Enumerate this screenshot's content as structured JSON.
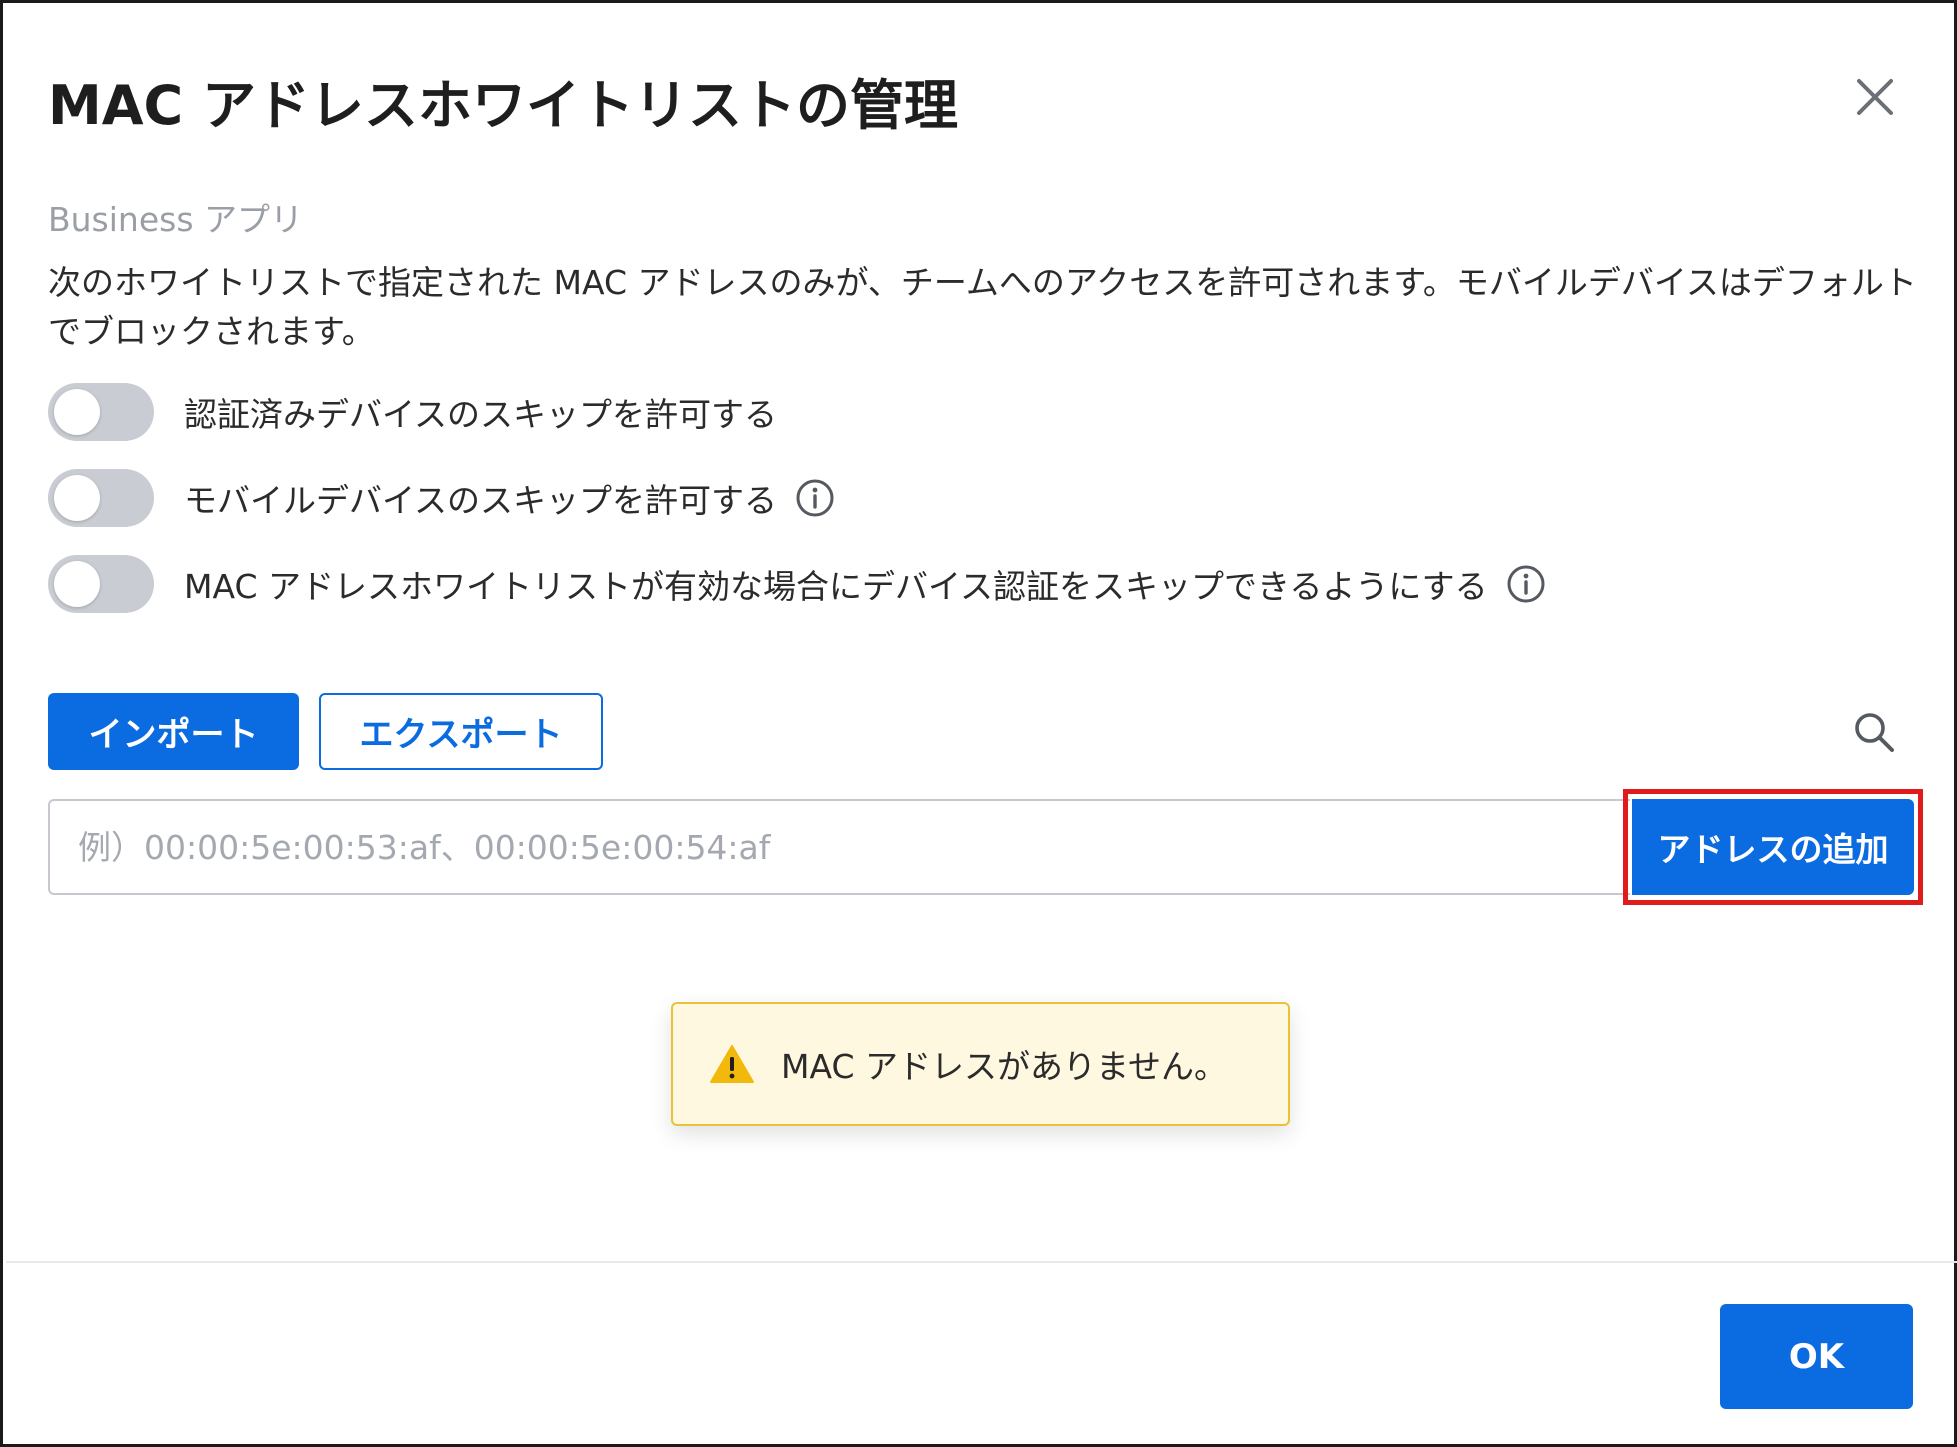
{
  "dialog": {
    "title": "MAC アドレスホワイトリストの管理",
    "subtitle": "Business アプリ",
    "description": "次のホワイトリストで指定された MAC アドレスのみが、チームへのアクセスを許可されます。モバイルデバイスはデフォルトでブロックされます。"
  },
  "toggles": [
    {
      "label": "認証済みデバイスのスキップを許可する",
      "on": false,
      "info": false
    },
    {
      "label": "モバイルデバイスのスキップを許可する",
      "on": false,
      "info": true
    },
    {
      "label": "MAC アドレスホワイトリストが有効な場合にデバイス認証をスキップできるようにする",
      "on": false,
      "info": true
    }
  ],
  "toolbar": {
    "import_label": "インポート",
    "export_label": "エクスポート",
    "search_icon": "search-icon"
  },
  "mac_input": {
    "placeholder": "例）00:00:5e:00:53:af、00:00:5e:00:54:af",
    "value": "",
    "add_label": "アドレスの追加"
  },
  "empty_state": {
    "icon": "warning-icon",
    "message": "MAC アドレスがありません。"
  },
  "footer": {
    "ok_label": "OK"
  },
  "colors": {
    "primary": "#0b6be0",
    "highlight": "#e01b1b",
    "warning_bg": "#fff8e1",
    "warning_border": "#e8c23b",
    "warning_icon": "#f2b90c",
    "toggle_off": "#c9ccd2"
  }
}
